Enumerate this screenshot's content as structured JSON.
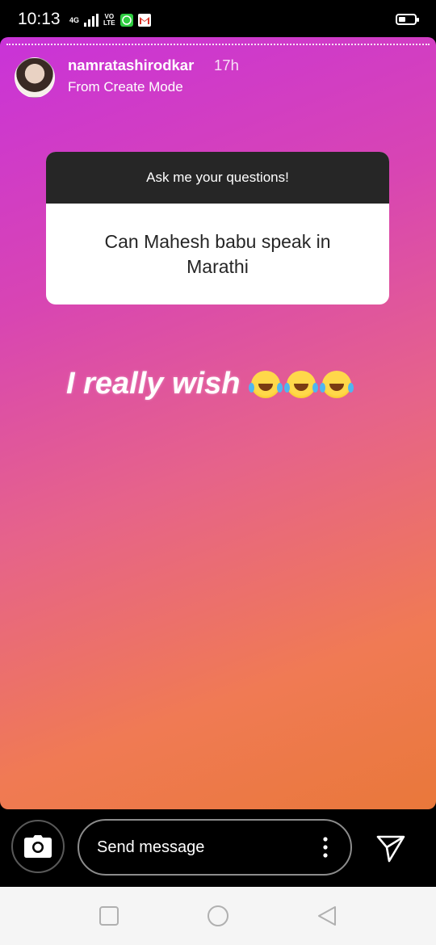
{
  "status_bar": {
    "time": "10:13",
    "network": "4G",
    "volte_top": "VO",
    "volte_bottom": "LTE"
  },
  "story": {
    "username": "namratashirodkar",
    "time_ago": "17h",
    "subtitle": "From Create Mode",
    "question_sticker": {
      "header": "Ask me your questions!",
      "question": "Can Mahesh babu speak in Marathi"
    },
    "caption": "I really wish",
    "caption_emojis": [
      "face-with-tears-of-joy",
      "face-with-tears-of-joy",
      "face-with-tears-of-joy"
    ]
  },
  "message_bar": {
    "placeholder": "Send message"
  },
  "icons": {
    "camera": "camera-icon",
    "more": "more-vertical-icon",
    "share": "paper-plane-icon",
    "recents": "square-icon",
    "home": "circle-icon",
    "back": "triangle-back-icon"
  },
  "colors": {
    "gradient_start": "#c933d8",
    "gradient_end": "#e9783a",
    "sticker_header": "#262626"
  }
}
